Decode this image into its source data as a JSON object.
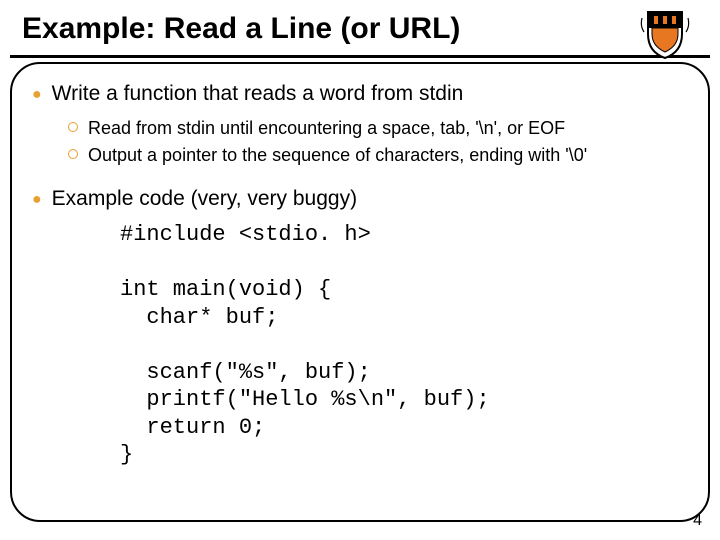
{
  "title": "Example: Read a Line (or URL)",
  "bullets": {
    "b1": "Write a function that reads a word from stdin",
    "s1": "Read from stdin until encountering a space, tab, '\\n', or EOF",
    "s2": "Output a pointer to the sequence of characters, ending with '\\0'",
    "b2": "Example code (very, very buggy)"
  },
  "code": "#include <stdio. h>\n\nint main(void) {\n  char* buf;\n\n  scanf(\"%s\", buf);\n  printf(\"Hello %s\\n\", buf);\n  return 0;\n}",
  "page": "4"
}
